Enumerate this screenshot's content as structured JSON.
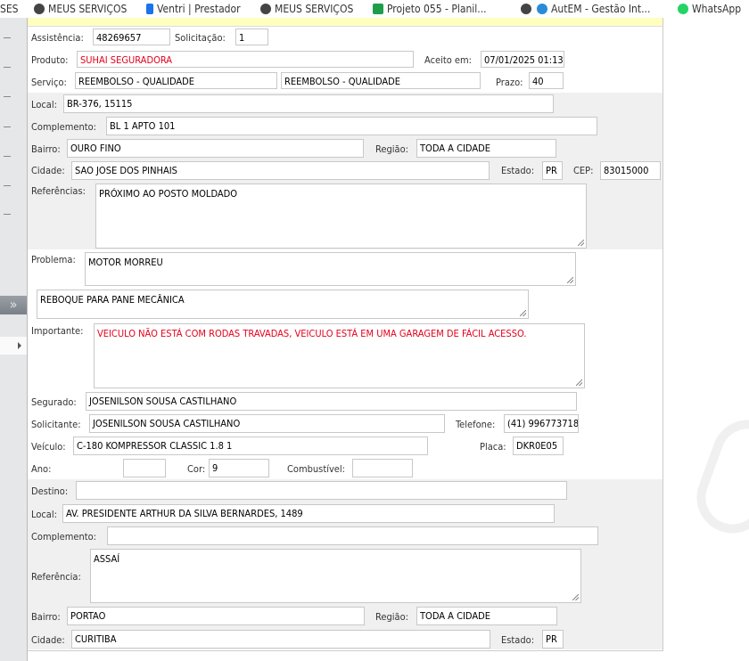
{
  "bookmarks": [
    "SES",
    "MEUS SERVIÇOS",
    "Ventri | Prestador",
    "MEUS SERVIÇOS",
    "Projeto 055 - Planil...",
    "AutEM - Gestão Int...",
    "WhatsApp"
  ],
  "colors": {
    "alert_text": "#e3001b",
    "header_strip": "#ffffc0",
    "section_bg": "#f0f0f0"
  },
  "sidebar": {
    "expand_icon": "double-chevron-right",
    "tree_icon": "triangle-right"
  },
  "form": {
    "assistencia_label": "Assistência:",
    "assistencia": "48269657",
    "solicitacao_label": "Solicitação:",
    "solicitacao": "1",
    "produto_label": "Produto:",
    "produto": "SUHAI SEGURADORA",
    "aceito_label": "Aceito em:",
    "aceito": "07/01/2025 01:13",
    "servico_label": "Serviço:",
    "servico1": "REEMBOLSO - QUALIDADE",
    "servico2": "REEMBOLSO - QUALIDADE",
    "prazo_label": "Prazo:",
    "prazo": "40",
    "local_label": "Local:",
    "local": "BR-376, 15115",
    "complemento_label": "Complemento:",
    "complemento": "BL 1 APTO 101",
    "bairro_label": "Bairro:",
    "bairro": "OURO FINO",
    "regiao_label": "Região:",
    "regiao": "TODA A CIDADE",
    "cidade_label": "Cidade:",
    "cidade": "SAO JOSE DOS PINHAIS",
    "estado_label": "Estado:",
    "estado": "PR",
    "cep_label": "CEP:",
    "cep": "83015000",
    "referencias_label": "Referências:",
    "referencias": "PRÓXIMO AO POSTO MOLDADO",
    "problema_label": "Problema:",
    "problema": "MOTOR MORREU",
    "descricao": "REBOQUE PARA PANE MECÂNICA",
    "importante_label": "Importante:",
    "importante": "VEICULO NÃO ESTÁ COM RODAS TRAVADAS,  VEICULO ESTÁ EM UMA GARAGEM DE FÁCIL ACESSO.",
    "segurado_label": "Segurado:",
    "segurado": "JOSENILSON SOUSA CASTILHANO",
    "solicitante_label": "Solicitante:",
    "solicitante": "JOSENILSON SOUSA CASTILHANO",
    "telefone_label": "Telefone:",
    "telefone": "(41) 996773718",
    "veiculo_label": "Veículo:",
    "veiculo": "C-180 KOMPRESSOR CLASSIC 1.8 1",
    "placa_label": "Placa:",
    "placa": "DKR0E05",
    "ano_label": "Ano:",
    "ano": "",
    "cor_label": "Cor:",
    "cor": "9",
    "combustivel_label": "Combustível:",
    "combustivel": ""
  },
  "destino": {
    "destino_label": "Destino:",
    "destino": "",
    "local_label": "Local:",
    "local": "AV. PRESIDENTE ARTHUR DA SILVA BERNARDES, 1489",
    "complemento_label": "Complemento:",
    "complemento": "",
    "referencia_label": "Referência:",
    "referencia": "ASSAÍ",
    "bairro_label": "Bairro:",
    "bairro": "PORTAO",
    "regiao_label": "Região:",
    "regiao": "TODA A CIDADE",
    "cidade_label": "Cidade:",
    "cidade": "CURITIBA",
    "estado_label": "Estado:",
    "estado": "PR"
  }
}
